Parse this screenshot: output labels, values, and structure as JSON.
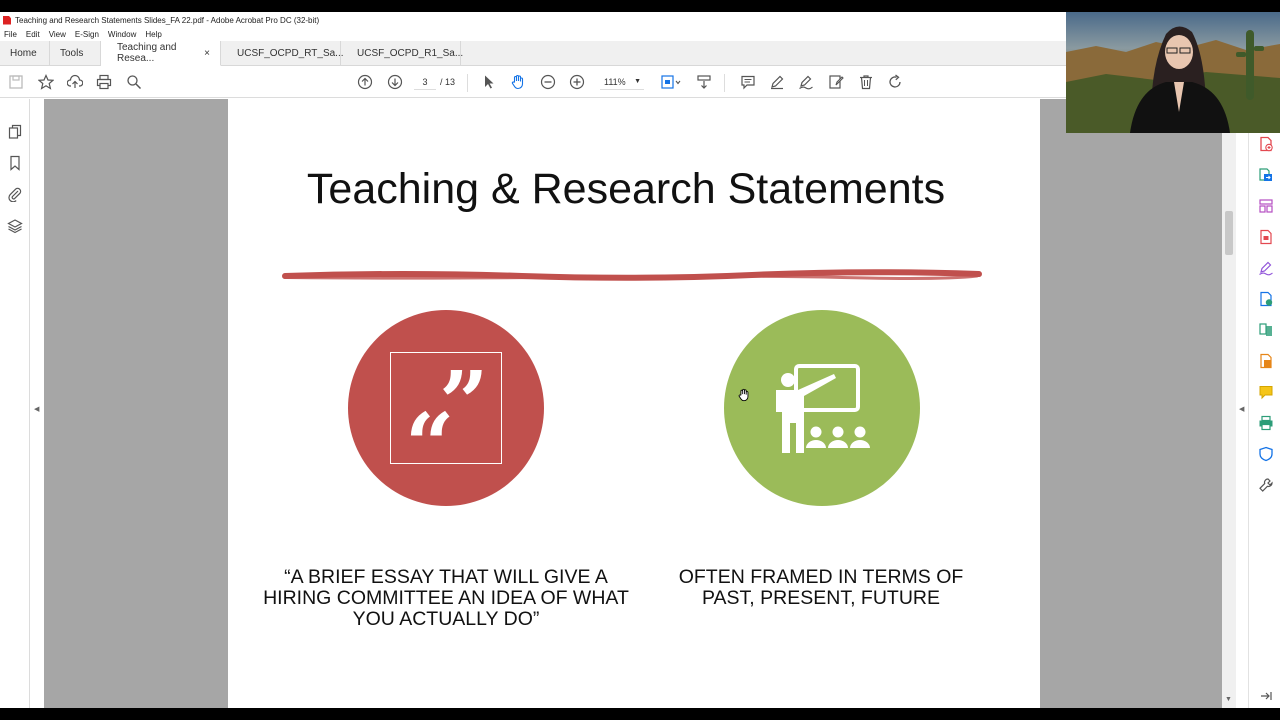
{
  "window": {
    "title": "Teaching and Research Statements Slides_FA 22.pdf - Adobe Acrobat Pro DC (32-bit)"
  },
  "menu": [
    "File",
    "Edit",
    "View",
    "E-Sign",
    "Window",
    "Help"
  ],
  "tabs": {
    "home": "Home",
    "tools": "Tools",
    "docs": [
      {
        "label": "Teaching and Resea...",
        "close": "×"
      },
      {
        "label": "UCSF_OCPD_RT_Sa..."
      },
      {
        "label": "UCSF_OCPD_R1_Sa..."
      }
    ]
  },
  "toolbar": {
    "page_current": "3",
    "page_total": "/ 13",
    "zoom": "111%"
  },
  "slide": {
    "title": "Teaching & Research Statements",
    "left_text": "“A BRIEF ESSAY THAT WILL GIVE A HIRING COMMITTEE AN IDEA OF WHAT YOU ACTUALLY DO”",
    "right_text": "OFTEN FRAMED IN TERMS OF PAST, PRESENT, FUTURE",
    "colors": {
      "red": "#c0504d",
      "green": "#9bbb59"
    },
    "icons": [
      "quote-icon",
      "teacher-presentation-icon"
    ]
  },
  "icons": {
    "left_nav": [
      "pages-icon",
      "bookmark-icon",
      "attachment-icon",
      "layers-icon"
    ],
    "right_panel": [
      "create-pdf-icon",
      "export-pdf-icon",
      "organize-pages-icon",
      "edit-pdf-icon",
      "fill-sign-icon",
      "request-signature-icon",
      "combine-files-icon",
      "compress-icon",
      "comment-icon",
      "print-production-icon",
      "protect-icon",
      "more-tools-icon"
    ]
  }
}
